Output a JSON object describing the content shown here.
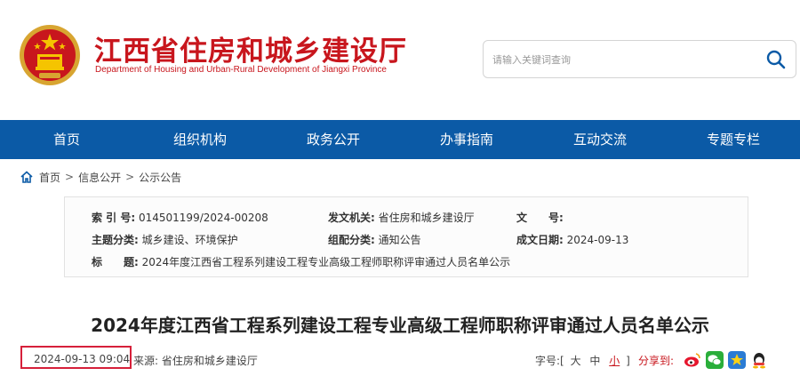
{
  "site": {
    "title": "江西省住房和城乡建设厅",
    "subtitle": "Department of Housing and Urban-Rural Development of Jiangxi Province"
  },
  "search": {
    "placeholder": "请输入关键词查询"
  },
  "nav": {
    "items": [
      "首页",
      "组织机构",
      "政务公开",
      "办事指南",
      "互动交流",
      "专题专栏"
    ]
  },
  "breadcrumb": {
    "home": "首页",
    "sep": ">",
    "level1": "信息公开",
    "level2": "公示公告"
  },
  "info": {
    "index_label": "索 引 号:",
    "index_value": "014501199/2024-00208",
    "issuer_label": "发文机关:",
    "issuer_value": "省住房和城乡建设厅",
    "doc_no_label": "文　　号:",
    "doc_no_value": "",
    "topic_label": "主题分类:",
    "topic_value": "城乡建设、环境保护",
    "category_label": "组配分类:",
    "category_value": "通知公告",
    "date_label": "成文日期:",
    "date_value": "2024-09-13",
    "title_label": "标　　题:",
    "title_value": "2024年度江西省工程系列建设工程专业高级工程师职称评审通过人员名单公示"
  },
  "article": {
    "title": "2024年度江西省工程系列建设工程专业高级工程师职称评审通过人员名单公示",
    "date": "2024-09-13 09:04",
    "source_label": "来源:",
    "source_value": "省住房和城乡建设厅",
    "font_label": "字号:[",
    "font_large": "大",
    "font_medium": "中",
    "font_small": "小",
    "font_end": "]",
    "share_label": "分享到:"
  },
  "colors": {
    "brand_red": "#c8161d",
    "nav_blue": "#0b5aa6",
    "highlight_red": "#d6203a"
  }
}
